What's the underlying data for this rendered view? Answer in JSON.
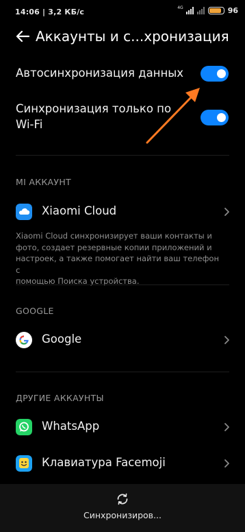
{
  "status": {
    "time": "14:06",
    "speed": "3,2 КБ/с",
    "network": "4G",
    "battery": "96"
  },
  "header": {
    "title": "Аккаунты и с...хронизация"
  },
  "settings": {
    "autosync": {
      "label": "Автосинхронизация данных",
      "on": true
    },
    "wifi_only": {
      "label_line1": "Синхронизация только по",
      "label_line2": "Wi-Fi",
      "on": true
    }
  },
  "sections": {
    "mi": {
      "title": "MI АККАУНТ",
      "item": "Xiaomi Cloud",
      "desc_lines": [
        "Xiaomi Cloud синхронизирует ваши контакты и",
        "фото, создает резервные копии приложений и",
        "настроек, а также помогает найти ваш телефон с",
        "помощью Поиска устройства."
      ]
    },
    "google": {
      "title": "GOOGLE",
      "item": "Google"
    },
    "other": {
      "title": "ДРУГИЕ АККАУНТЫ",
      "items": [
        "WhatsApp",
        "Клавиатура Facemoji"
      ]
    }
  },
  "bottom": {
    "label": "Синхронизиров..."
  },
  "colors": {
    "accent": "#0d84ff",
    "annotation_arrow": "#ff7a22"
  }
}
